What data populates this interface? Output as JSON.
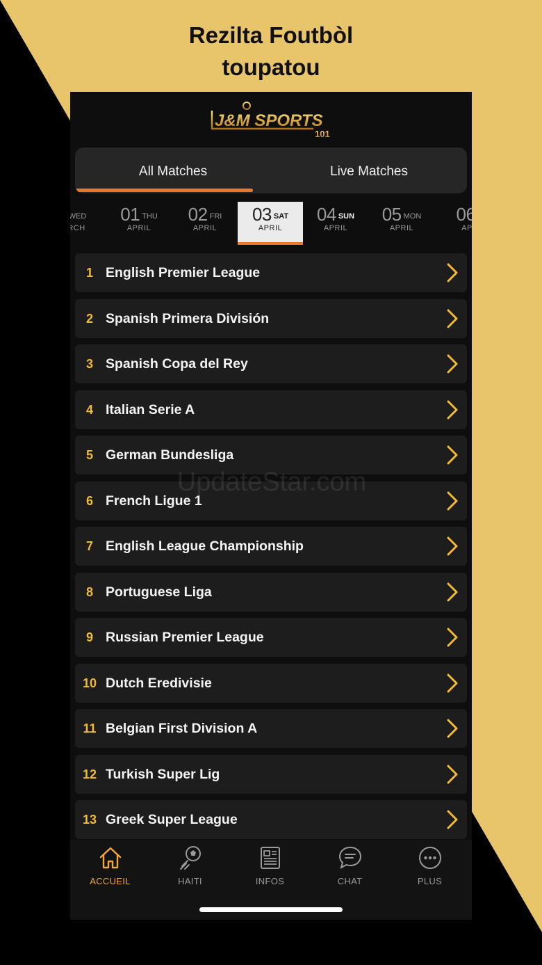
{
  "headline": {
    "line1": "Rezilta Foutbòl",
    "line2": "toupatou"
  },
  "colors": {
    "background": "#e8c46a",
    "accent": "#e9792a",
    "rank": "#f3bb32",
    "nav_active": "#f2a93a"
  },
  "logo": {
    "text": "J&M SPORTS",
    "sub": "101"
  },
  "tabs": {
    "all": "All Matches",
    "live": "Live Matches"
  },
  "dates": [
    {
      "num": "",
      "day": "WED",
      "month": "RCH"
    },
    {
      "num": "01",
      "day": "THU",
      "month": "APRIL"
    },
    {
      "num": "02",
      "day": "FRI",
      "month": "APRIL"
    },
    {
      "num": "03",
      "day": "SAT",
      "month": "APRIL"
    },
    {
      "num": "04",
      "day": "SUN",
      "month": "APRIL"
    },
    {
      "num": "05",
      "day": "MON",
      "month": "APRIL"
    },
    {
      "num": "06",
      "day": "",
      "month": "AP"
    }
  ],
  "leagues": [
    {
      "rank": "1",
      "name": "English Premier League"
    },
    {
      "rank": "2",
      "name": "Spanish Primera División"
    },
    {
      "rank": "3",
      "name": "Spanish Copa del Rey"
    },
    {
      "rank": "4",
      "name": "Italian Serie A"
    },
    {
      "rank": "5",
      "name": "German Bundesliga"
    },
    {
      "rank": "6",
      "name": "French Ligue 1"
    },
    {
      "rank": "7",
      "name": "English League Championship"
    },
    {
      "rank": "8",
      "name": "Portuguese Liga"
    },
    {
      "rank": "9",
      "name": "Russian Premier League"
    },
    {
      "rank": "10",
      "name": "Dutch Eredivisie"
    },
    {
      "rank": "11",
      "name": "Belgian First Division A"
    },
    {
      "rank": "12",
      "name": "Turkish Super Lig"
    },
    {
      "rank": "13",
      "name": "Greek Super League"
    }
  ],
  "watermark": "UpdateStar.com",
  "nav": [
    {
      "label": "ACCUEIL",
      "icon": "home-icon"
    },
    {
      "label": "HAITI",
      "icon": "soccer-icon"
    },
    {
      "label": "INFOS",
      "icon": "news-icon"
    },
    {
      "label": "CHAT",
      "icon": "chat-icon"
    },
    {
      "label": "PLUS",
      "icon": "more-icon"
    }
  ]
}
